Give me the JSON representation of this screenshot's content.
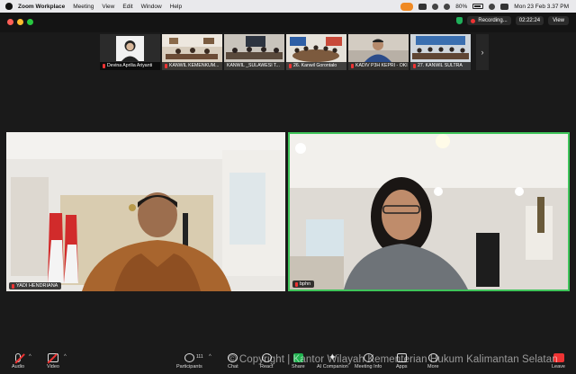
{
  "menubar": {
    "app_name": "Zoom Workplace",
    "menus": [
      "Meeting",
      "View",
      "Edit",
      "Window",
      "Help"
    ],
    "battery_pct": "80%",
    "datetime": "Mon 23 Feb  3.37 PM"
  },
  "window": {
    "recording_label": "Recording...",
    "timer": "02:22:24",
    "view_label": "View"
  },
  "thumbnails": [
    {
      "label": "Devina Aprilia Ariyanti",
      "kind": "avatar",
      "muted": true
    },
    {
      "label": "KANWIL KEMENKUM...",
      "kind": "room",
      "muted": true
    },
    {
      "label": "KANWIL _SULAWESI T...",
      "kind": "room",
      "muted": false
    },
    {
      "label": "26. Kanwil Gorontalo",
      "kind": "room",
      "muted": true
    },
    {
      "label": "KADIV P3H KEPRI - OKI",
      "kind": "person",
      "muted": true
    },
    {
      "label": "27. KANWIL SULTRA",
      "kind": "room",
      "muted": true
    }
  ],
  "tiles": {
    "left_name": "YADI HENDRIANA",
    "right_name": "bphn"
  },
  "toolbar": {
    "audio": "Audio",
    "video": "Video",
    "participants": "Participants",
    "participants_count": "111",
    "chat": "Chat",
    "react": "React",
    "share": "Share",
    "ai_companion": "AI Companion",
    "meeting_info": "Meeting Info",
    "apps": "Apps",
    "more": "More",
    "leave": "Leave"
  },
  "watermark": "© Copyright | Kantor Wilayah Kementerian Hukum Kalimantan Selatan",
  "colors": {
    "active_speaker_border": "#3fc45a",
    "muted_red": "#e33333",
    "share_green": "#20b24f"
  }
}
